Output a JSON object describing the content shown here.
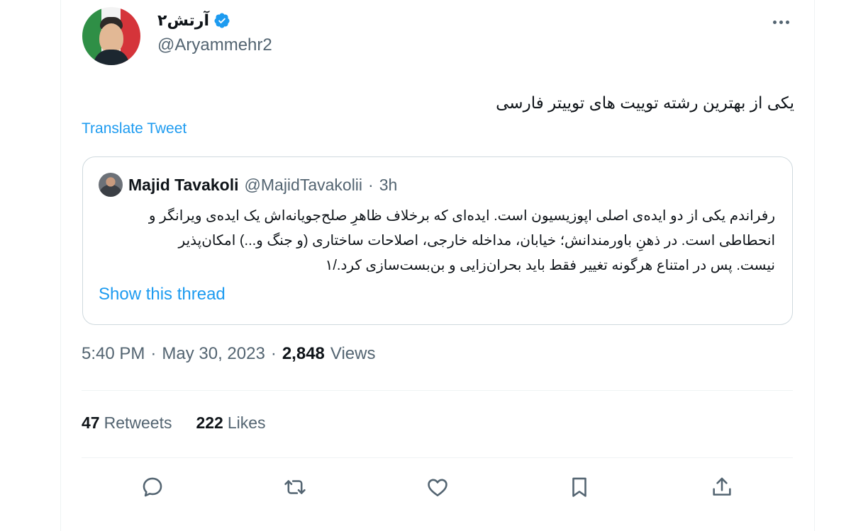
{
  "author": {
    "display_name": "آرتش۲",
    "handle": "@Aryammehr2",
    "verified": true
  },
  "tweet": {
    "text": "یکی از بهترین رشته توییت های توییتر فارسی",
    "translate_label": "Translate Tweet"
  },
  "quoted": {
    "name": "Majid Tavakoli",
    "handle": "@MajidTavakolii",
    "separator": "·",
    "time": "3h",
    "lines": [
      "رفراندم یکی از دو ایده‌ی اصلی اپوزیسیون است. ایده‌ای که برخلاف ظاهرِ صلح‌جویانه‌اش یک ایده‌ی ویرانگر و",
      "انحطاطی است. در ذهنِ باورمندانش؛ خیابان، مداخله خارجی، اصلاحات ساختاری (و جنگ و...) امکان‌پذیر",
      "نیست. پس در امتناع هرگونه تغییر فقط باید بحران‌زایی و بن‌بست‌سازی کرد./۱"
    ],
    "show_thread_label": "Show this thread"
  },
  "meta": {
    "time": "5:40 PM",
    "sep1": "·",
    "date": "May 30, 2023",
    "sep2": "·",
    "views_count": "2,848",
    "views_label": "Views"
  },
  "stats": {
    "retweets_count": "47",
    "retweets_label": "Retweets",
    "likes_count": "222",
    "likes_label": "Likes"
  },
  "icons": {
    "more": "more-horizontal-icon",
    "verified": "verified-badge-icon",
    "reply": "reply-icon",
    "retweet": "retweet-icon",
    "like": "like-icon",
    "bookmark": "bookmark-icon",
    "share": "share-icon"
  },
  "colors": {
    "link": "#1d9bf0",
    "secondary_text": "#536471",
    "border": "#cfd9de",
    "verified": "#1d9bf0"
  }
}
